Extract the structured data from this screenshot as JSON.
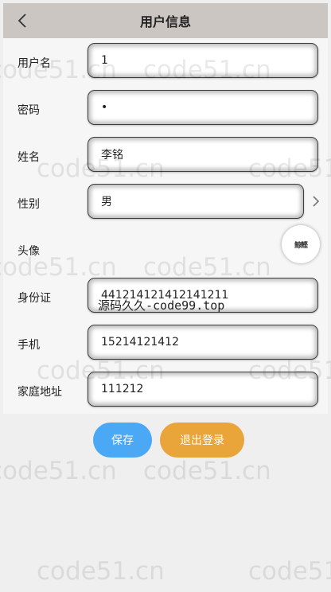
{
  "header": {
    "title": "用户信息",
    "back_icon": "chevron-left-icon"
  },
  "form": {
    "fields": [
      {
        "label": "用户名",
        "value": "1"
      },
      {
        "label": "密码",
        "value": "•"
      },
      {
        "label": "姓名",
        "value": "李铭"
      },
      {
        "label": "性别",
        "value": "男"
      },
      {
        "label": "头像",
        "avatar_text": "鲸鲣"
      },
      {
        "label": "身份证",
        "value": "441214121412141211"
      },
      {
        "label": "手机",
        "value": "15214121412"
      },
      {
        "label": "家庭地址",
        "value": "111212"
      }
    ]
  },
  "overlay": {
    "text": "源码久久-code99.top"
  },
  "buttons": {
    "save": "保存",
    "logout": "退出登录"
  },
  "watermark": {
    "text": "code51.cn"
  },
  "colors": {
    "header_bg": "#cbc6c2",
    "save_bg": "#4ba8f5",
    "logout_bg": "#e9a43a"
  }
}
